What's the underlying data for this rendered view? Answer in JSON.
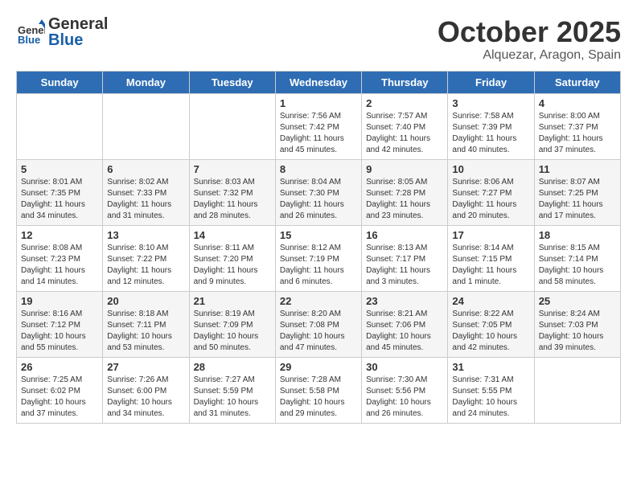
{
  "header": {
    "logo_general": "General",
    "logo_blue": "Blue",
    "month": "October 2025",
    "location": "Alquezar, Aragon, Spain"
  },
  "weekdays": [
    "Sunday",
    "Monday",
    "Tuesday",
    "Wednesday",
    "Thursday",
    "Friday",
    "Saturday"
  ],
  "weeks": [
    [
      {
        "day": "",
        "info": ""
      },
      {
        "day": "",
        "info": ""
      },
      {
        "day": "",
        "info": ""
      },
      {
        "day": "1",
        "info": "Sunrise: 7:56 AM\nSunset: 7:42 PM\nDaylight: 11 hours\nand 45 minutes."
      },
      {
        "day": "2",
        "info": "Sunrise: 7:57 AM\nSunset: 7:40 PM\nDaylight: 11 hours\nand 42 minutes."
      },
      {
        "day": "3",
        "info": "Sunrise: 7:58 AM\nSunset: 7:39 PM\nDaylight: 11 hours\nand 40 minutes."
      },
      {
        "day": "4",
        "info": "Sunrise: 8:00 AM\nSunset: 7:37 PM\nDaylight: 11 hours\nand 37 minutes."
      }
    ],
    [
      {
        "day": "5",
        "info": "Sunrise: 8:01 AM\nSunset: 7:35 PM\nDaylight: 11 hours\nand 34 minutes."
      },
      {
        "day": "6",
        "info": "Sunrise: 8:02 AM\nSunset: 7:33 PM\nDaylight: 11 hours\nand 31 minutes."
      },
      {
        "day": "7",
        "info": "Sunrise: 8:03 AM\nSunset: 7:32 PM\nDaylight: 11 hours\nand 28 minutes."
      },
      {
        "day": "8",
        "info": "Sunrise: 8:04 AM\nSunset: 7:30 PM\nDaylight: 11 hours\nand 26 minutes."
      },
      {
        "day": "9",
        "info": "Sunrise: 8:05 AM\nSunset: 7:28 PM\nDaylight: 11 hours\nand 23 minutes."
      },
      {
        "day": "10",
        "info": "Sunrise: 8:06 AM\nSunset: 7:27 PM\nDaylight: 11 hours\nand 20 minutes."
      },
      {
        "day": "11",
        "info": "Sunrise: 8:07 AM\nSunset: 7:25 PM\nDaylight: 11 hours\nand 17 minutes."
      }
    ],
    [
      {
        "day": "12",
        "info": "Sunrise: 8:08 AM\nSunset: 7:23 PM\nDaylight: 11 hours\nand 14 minutes."
      },
      {
        "day": "13",
        "info": "Sunrise: 8:10 AM\nSunset: 7:22 PM\nDaylight: 11 hours\nand 12 minutes."
      },
      {
        "day": "14",
        "info": "Sunrise: 8:11 AM\nSunset: 7:20 PM\nDaylight: 11 hours\nand 9 minutes."
      },
      {
        "day": "15",
        "info": "Sunrise: 8:12 AM\nSunset: 7:19 PM\nDaylight: 11 hours\nand 6 minutes."
      },
      {
        "day": "16",
        "info": "Sunrise: 8:13 AM\nSunset: 7:17 PM\nDaylight: 11 hours\nand 3 minutes."
      },
      {
        "day": "17",
        "info": "Sunrise: 8:14 AM\nSunset: 7:15 PM\nDaylight: 11 hours\nand 1 minute."
      },
      {
        "day": "18",
        "info": "Sunrise: 8:15 AM\nSunset: 7:14 PM\nDaylight: 10 hours\nand 58 minutes."
      }
    ],
    [
      {
        "day": "19",
        "info": "Sunrise: 8:16 AM\nSunset: 7:12 PM\nDaylight: 10 hours\nand 55 minutes."
      },
      {
        "day": "20",
        "info": "Sunrise: 8:18 AM\nSunset: 7:11 PM\nDaylight: 10 hours\nand 53 minutes."
      },
      {
        "day": "21",
        "info": "Sunrise: 8:19 AM\nSunset: 7:09 PM\nDaylight: 10 hours\nand 50 minutes."
      },
      {
        "day": "22",
        "info": "Sunrise: 8:20 AM\nSunset: 7:08 PM\nDaylight: 10 hours\nand 47 minutes."
      },
      {
        "day": "23",
        "info": "Sunrise: 8:21 AM\nSunset: 7:06 PM\nDaylight: 10 hours\nand 45 minutes."
      },
      {
        "day": "24",
        "info": "Sunrise: 8:22 AM\nSunset: 7:05 PM\nDaylight: 10 hours\nand 42 minutes."
      },
      {
        "day": "25",
        "info": "Sunrise: 8:24 AM\nSunset: 7:03 PM\nDaylight: 10 hours\nand 39 minutes."
      }
    ],
    [
      {
        "day": "26",
        "info": "Sunrise: 7:25 AM\nSunset: 6:02 PM\nDaylight: 10 hours\nand 37 minutes."
      },
      {
        "day": "27",
        "info": "Sunrise: 7:26 AM\nSunset: 6:00 PM\nDaylight: 10 hours\nand 34 minutes."
      },
      {
        "day": "28",
        "info": "Sunrise: 7:27 AM\nSunset: 5:59 PM\nDaylight: 10 hours\nand 31 minutes."
      },
      {
        "day": "29",
        "info": "Sunrise: 7:28 AM\nSunset: 5:58 PM\nDaylight: 10 hours\nand 29 minutes."
      },
      {
        "day": "30",
        "info": "Sunrise: 7:30 AM\nSunset: 5:56 PM\nDaylight: 10 hours\nand 26 minutes."
      },
      {
        "day": "31",
        "info": "Sunrise: 7:31 AM\nSunset: 5:55 PM\nDaylight: 10 hours\nand 24 minutes."
      },
      {
        "day": "",
        "info": ""
      }
    ]
  ]
}
